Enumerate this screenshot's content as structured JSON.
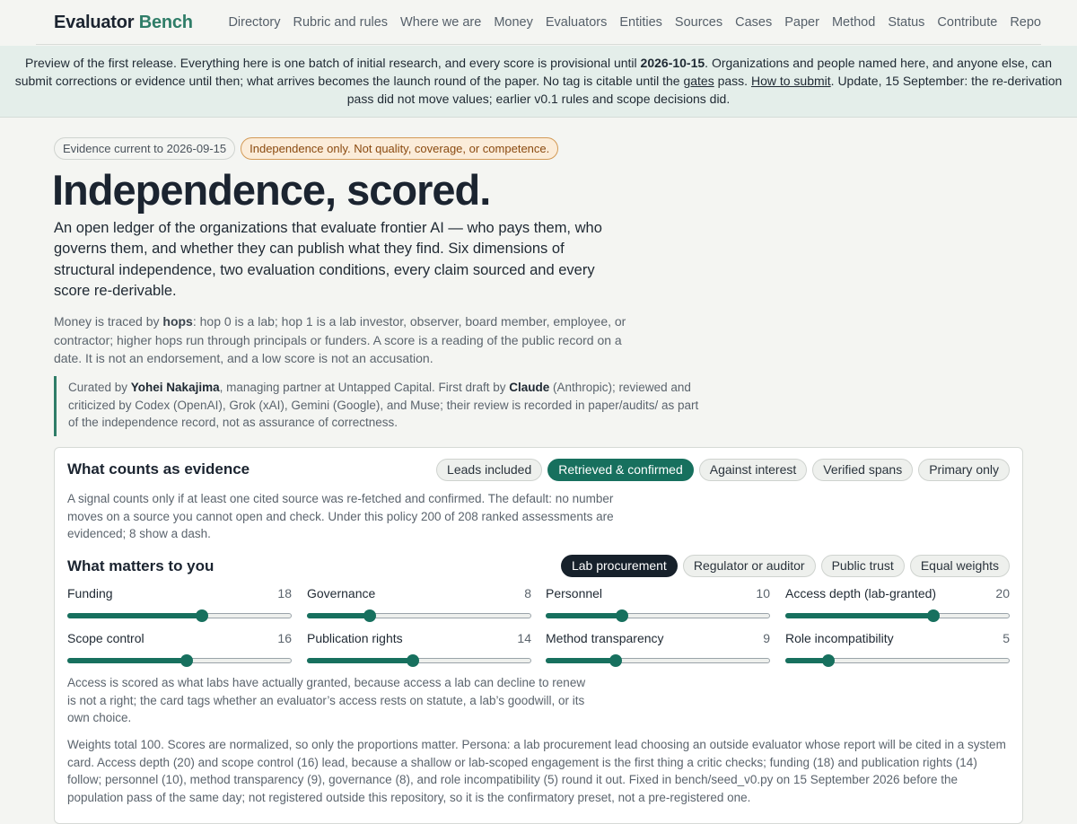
{
  "header": {
    "brand_main": "Evaluator",
    "brand_accent": "Bench",
    "nav": [
      "Directory",
      "Rubric and rules",
      "Where we are",
      "Money",
      "Evaluators",
      "Entities",
      "Sources",
      "Cases",
      "Paper",
      "Method",
      "Status",
      "Contribute",
      "Repo"
    ]
  },
  "banner": {
    "t1": "Preview of the first release. Everything here is one batch of initial research, and every score is provisional until ",
    "date": "2026-10-15",
    "t2": ". Organizations and people named here, and anyone else, can submit corrections or evidence until then; what arrives becomes the launch round of the paper. No tag is citable until the ",
    "gates_link": "gates",
    "t3": " pass. ",
    "how_link": "How to submit",
    "t4": ". Update, 15 September: the re-derivation pass did not move values; earlier v0.1 rules and scope decisions did."
  },
  "hero": {
    "chip_evidence": "Evidence current to 2026-09-15",
    "chip_scope": "Independence only. Not quality, coverage, or competence.",
    "title": "Independence, scored.",
    "lede": "An open ledger of the organizations that evaluate frontier AI — who pays them, who governs them, and whether they can publish what they find. Six dimensions of structural independence, two evaluation conditions, every claim sourced and every score re-derivable.",
    "sub_t1": "Money is traced by ",
    "sub_hops": "hops",
    "sub_t2": ": hop 0 is a lab; hop 1 is a lab investor, observer, board member, employee, or contractor; higher hops run through principals or funders. A score is a reading of the public record on a date. It is not an endorsement, and a low score is not an accusation.",
    "cur_t1": "Curated by ",
    "cur_name": "Yohei Nakajima",
    "cur_t2": ", managing partner at Untapped Capital. First draft by ",
    "cur_claude": "Claude",
    "cur_t3": " (Anthropic); reviewed and criticized by Codex (OpenAI), Grok (xAI), Gemini (Google), and Muse; their review is recorded in paper/audits/ as part of the independence record, not as assurance of correctness."
  },
  "evidence": {
    "title": "What counts as evidence",
    "options": [
      "Leads included",
      "Retrieved & confirmed",
      "Against interest",
      "Verified spans",
      "Primary only"
    ],
    "selected": "Retrieved & confirmed",
    "desc": "A signal counts only if at least one cited source was re-fetched and confirmed. The default: no number moves on a source you cannot open and check. Under this policy 200 of 208 ranked assessments are evidenced; 8 show a dash."
  },
  "matters": {
    "title": "What matters to you",
    "presets": [
      "Lab procurement",
      "Regulator or auditor",
      "Public trust",
      "Equal weights"
    ],
    "selected": "Lab procurement",
    "weights": [
      {
        "label": "Funding",
        "value": 18,
        "pos": 0.6
      },
      {
        "label": "Governance",
        "value": 8,
        "pos": 0.28
      },
      {
        "label": "Personnel",
        "value": 10,
        "pos": 0.34
      },
      {
        "label": "Access depth (lab-granted)",
        "value": 20,
        "pos": 0.66
      },
      {
        "label": "Scope control",
        "value": 16,
        "pos": 0.53
      },
      {
        "label": "Publication rights",
        "value": 14,
        "pos": 0.47
      },
      {
        "label": "Method transparency",
        "value": 9,
        "pos": 0.31
      },
      {
        "label": "Role incompatibility",
        "value": 5,
        "pos": 0.19
      }
    ],
    "note_access": "Access is scored as what labs have actually granted, because access a lab can decline to renew is not a right; the card tags whether an evaluator’s access rests on statute, a lab’s goodwill, or its own choice.",
    "note_weights": "Weights total 100. Scores are normalized, so only the proportions matter. Persona: a lab procurement lead choosing an outside evaluator whose report will be cited in a system card. Access depth (20) and scope control (16) lead, because a shallow or lab-scoped engagement is the first thing a critic checks; funding (18) and publication rights (14) follow; personnel (10), method transparency (9), governance (8), and role incompatibility (5) round it out. Fixed in bench/seed_v0.py on 15 September 2026 before the population pass of the same day; not registered outside this repository, so it is the confirmatory preset, not a pre-registered one."
  },
  "colors": {
    "accent": "#2f7d68",
    "slider": "#17705e",
    "dark_pill": "#17212b",
    "warn_chip": "#fbecd9"
  }
}
